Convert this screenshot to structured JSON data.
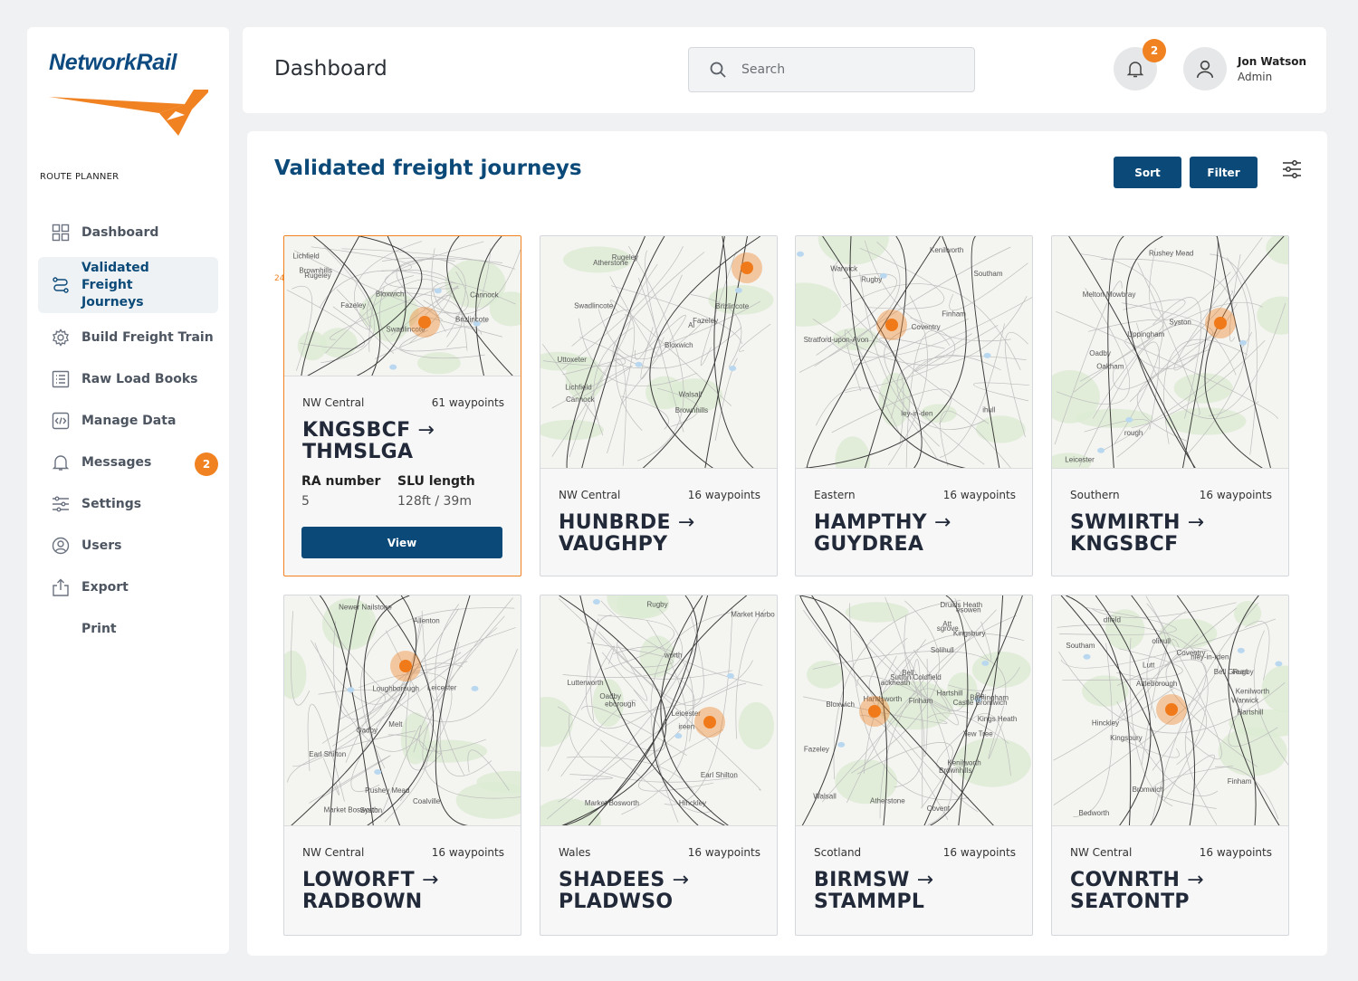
{
  "brand": {
    "logo_text": "NetworkRail",
    "orange": "#f08222",
    "navy": "#0b4a78"
  },
  "sidebar": {
    "section_label": "ROUTE PLANNER",
    "items": [
      {
        "label": "Dashboard",
        "icon": "grid-icon"
      },
      {
        "label": "Validated Freight Journeys",
        "icon": "route-icon",
        "active": true
      },
      {
        "label": "Build Freight Train",
        "icon": "gear-icon"
      },
      {
        "label": "Raw Load Books",
        "icon": "list-icon"
      },
      {
        "label": "Manage Data",
        "icon": "code-icon"
      },
      {
        "label": "Messages",
        "icon": "bell-icon",
        "badge": "2"
      },
      {
        "label": "Settings",
        "icon": "sliders-icon"
      },
      {
        "label": "Users",
        "icon": "user-circle-icon"
      },
      {
        "label": "Export",
        "icon": "export-icon"
      },
      {
        "label": "Print",
        "icon": ""
      }
    ]
  },
  "header": {
    "title": "Dashboard",
    "search_placeholder": "Search",
    "notifications_count": "2",
    "user_name": "Jon Watson",
    "user_role": "Admin"
  },
  "main": {
    "title": "Validated freight journeys",
    "sort_label": "Sort",
    "filter_label": "Filter",
    "cards": [
      {
        "region": "NW Central",
        "waypoints": "61 waypoints",
        "from": "KNGSBCF",
        "to": "THMSLGA",
        "ra_label": "RA number",
        "ra_value": "5",
        "slu_label": "SLU length",
        "slu_value": "128ft / 39m",
        "view_label": "View",
        "map_marker_label": "24",
        "places": [
          "Swadlincote",
          "Rugeley",
          "Cannock",
          "Lichfield",
          "Brownhills",
          "Bloxwich",
          "Fazeley",
          "Brizlincote"
        ]
      },
      {
        "region": "NW Central",
        "waypoints": "16 waypoints",
        "from": "HUNBRDE",
        "to": "VAUGHPY",
        "places": [
          "Uttoxeter",
          "Brizlincote",
          "Swadlincote",
          "Rugeley",
          "Lichfield",
          "Brownhills",
          "Bloxwich",
          "Walsall",
          "Fazeley",
          "Atherstone",
          "Cannock",
          "Al"
        ]
      },
      {
        "region": "Eastern",
        "waypoints": "16 waypoints",
        "from": "HAMPTHY",
        "to": "GUYDREA",
        "places": [
          "Coventry",
          "Finham",
          "Rugby",
          "Kenilworth",
          "Warwick",
          "Southam",
          "Stratford-upon-Avon",
          "ley-in-den",
          "ihull"
        ]
      },
      {
        "region": "Southern",
        "waypoints": "16 waypoints",
        "from": "SWMIRTH",
        "to": "KNGSBCF",
        "places": [
          "Melton Mowbray",
          "Syston",
          "Rushey Mead",
          "Leicester",
          "Oakham",
          "Oadby",
          "Uppingham",
          "rough"
        ]
      },
      {
        "region": "NW Central",
        "waypoints": "16 waypoints",
        "from": "LOWORFT",
        "to": "RADBOWN",
        "places": [
          "Allenton",
          "Loughborough",
          "Coalville",
          "Syston",
          "Newer Nailstone",
          "Rushey Mead",
          "Leicester",
          "Market Bosworth",
          "Oadby",
          "Earl Shilton",
          "Melt"
        ]
      },
      {
        "region": "Wales",
        "waypoints": "16 waypoints",
        "from": "SHADEES",
        "to": "PLADWSO",
        "places": [
          "Market Bosworth",
          "Oadby",
          "Earl Shilton",
          "Hinckley",
          "eborough",
          "worth",
          "Lutterworth",
          "Market Harbo",
          "Rugby",
          "ireen",
          "Leicester"
        ]
      },
      {
        "region": "Scotland",
        "waypoints": "16 waypoints",
        "from": "BIRMSW",
        "to": "STAMMPL",
        "places": [
          "Brownhills",
          "Bloxwich",
          "Fazeley",
          "Walsall",
          "Atherstone",
          "Yew Tree",
          "Sutton Coldfield",
          "Kingsbury",
          "Hartshill",
          "Handsworth",
          "Castle Bromwich",
          "Birmingham",
          "Kings Heath",
          "Solihull",
          "Druids Heath",
          "Covent",
          "Kenilworth",
          "Finham",
          "esowen",
          "ackheath",
          "sgrove",
          "Att",
          "Be",
          "Bell"
        ]
      },
      {
        "region": "NW Central",
        "waypoints": "16 waypoints",
        "from": "COVNRTH",
        "to": "SEATONTP",
        "places": [
          "Kingsbury",
          "Hartshill",
          "Hinckley",
          "Bromwich",
          "Attleborough",
          "Bedworth",
          "Bell Green",
          "Coventry",
          "Finham",
          "Rugby",
          "Kenilworth",
          "Warwick",
          "Southam",
          "nley-in-rden",
          "olihull",
          "Lutt",
          "dfield"
        ]
      }
    ]
  }
}
